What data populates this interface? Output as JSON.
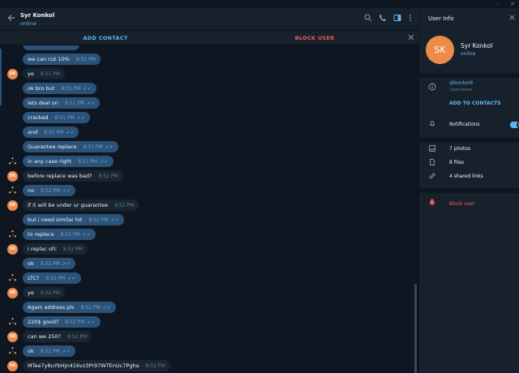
{
  "window": {
    "minimize_icon": "minimize-icon",
    "close_icon": "close-icon",
    "minimize_glyph": "–",
    "close_glyph": "✕"
  },
  "header": {
    "name": "Syr Konkol",
    "status": "online",
    "icons": [
      "back-arrow-icon",
      "search-icon",
      "phone-icon",
      "sidebar-toggle-icon",
      "more-vertical-icon"
    ]
  },
  "actionbar": {
    "add_contact": "ADD CONTACT",
    "block_user": "BLOCK USER"
  },
  "messages": [
    {
      "side": "out",
      "text": "",
      "time": "",
      "ticks": ""
    },
    {
      "side": "out",
      "text": "we can cut 10%",
      "time": "8:51 PM",
      "ticks": ""
    },
    {
      "side": "in",
      "avatar": "SK",
      "text": "ye",
      "time": "8:51 PM"
    },
    {
      "side": "out",
      "text": "ok bro but",
      "time": "8:51 PM",
      "ticks": "✓✓"
    },
    {
      "side": "out",
      "text": "lets deal on",
      "time": "8:51 PM",
      "ticks": "✓✓"
    },
    {
      "side": "out",
      "text": "cracked",
      "time": "8:51 PM",
      "ticks": "✓✓"
    },
    {
      "side": "out",
      "text": "and",
      "time": "8:51 PM",
      "ticks": "✓✓"
    },
    {
      "side": "out",
      "text": "Guarantee replace",
      "time": "8:51 PM",
      "ticks": "✓✓"
    },
    {
      "side": "out",
      "avatar": "me",
      "text": "in any case right",
      "time": "8:51 PM",
      "ticks": "✓✓"
    },
    {
      "side": "in",
      "avatar": "SK",
      "text": "before replace was bad?",
      "time": "8:52 PM"
    },
    {
      "side": "out",
      "avatar": "me",
      "text": "no",
      "time": "8:52 PM",
      "ticks": "✓✓"
    },
    {
      "side": "in",
      "avatar": "SK",
      "text": "if it will be under ur guarantee",
      "time": "8:52 PM"
    },
    {
      "side": "out",
      "text": "but i need similar hit",
      "time": "8:52 PM",
      "ticks": "✓✓"
    },
    {
      "side": "out",
      "avatar": "me",
      "text": "to replace",
      "time": "8:52 PM",
      "ticks": "✓✓"
    },
    {
      "side": "in",
      "avatar": "SK",
      "text": "i replac ofc",
      "time": "8:52 PM"
    },
    {
      "side": "out",
      "text": "ok",
      "time": "8:52 PM",
      "ticks": "✓✓"
    },
    {
      "side": "out",
      "avatar": "me",
      "text": "LTC?",
      "time": "8:52 PM",
      "ticks": "✓✓"
    },
    {
      "side": "in",
      "avatar": "SK",
      "text": "ye",
      "time": "8:52 PM"
    },
    {
      "side": "out",
      "text": "Again address pls",
      "time": "8:52 PM",
      "ticks": "✓✓"
    },
    {
      "side": "out",
      "avatar": "me",
      "text": "220$ good?",
      "time": "8:52 PM",
      "ticks": "✓✓"
    },
    {
      "side": "in",
      "avatar": "SK",
      "text": "can we 250?",
      "time": "8:52 PM"
    },
    {
      "side": "out",
      "avatar": "me",
      "text": "ok",
      "time": "8:52 PM",
      "ticks": "✓✓"
    },
    {
      "side": "in",
      "avatar": "SK",
      "text": "MTee7y8uYbHJn416vz3Pr97WTEnUc7Pgha",
      "time": "8:52 PM"
    }
  ],
  "info": {
    "title": "User Info",
    "avatar_initials": "SK",
    "name": "Syr Konkol",
    "status": "online",
    "username": "@konkol4",
    "username_label": "Username",
    "add_to_contacts": "ADD TO CONTACTS",
    "notifications": "Notifications",
    "notifications_on": true,
    "photos": "7 photos",
    "files": "8 files",
    "links": "4 shared links",
    "block_user": "Block user"
  },
  "colors": {
    "accent": "#5eb5f7",
    "danger": "#ef5b5b",
    "outgoing": "#2b5278",
    "incoming": "#182533",
    "avatar": "#ee8a4a"
  }
}
